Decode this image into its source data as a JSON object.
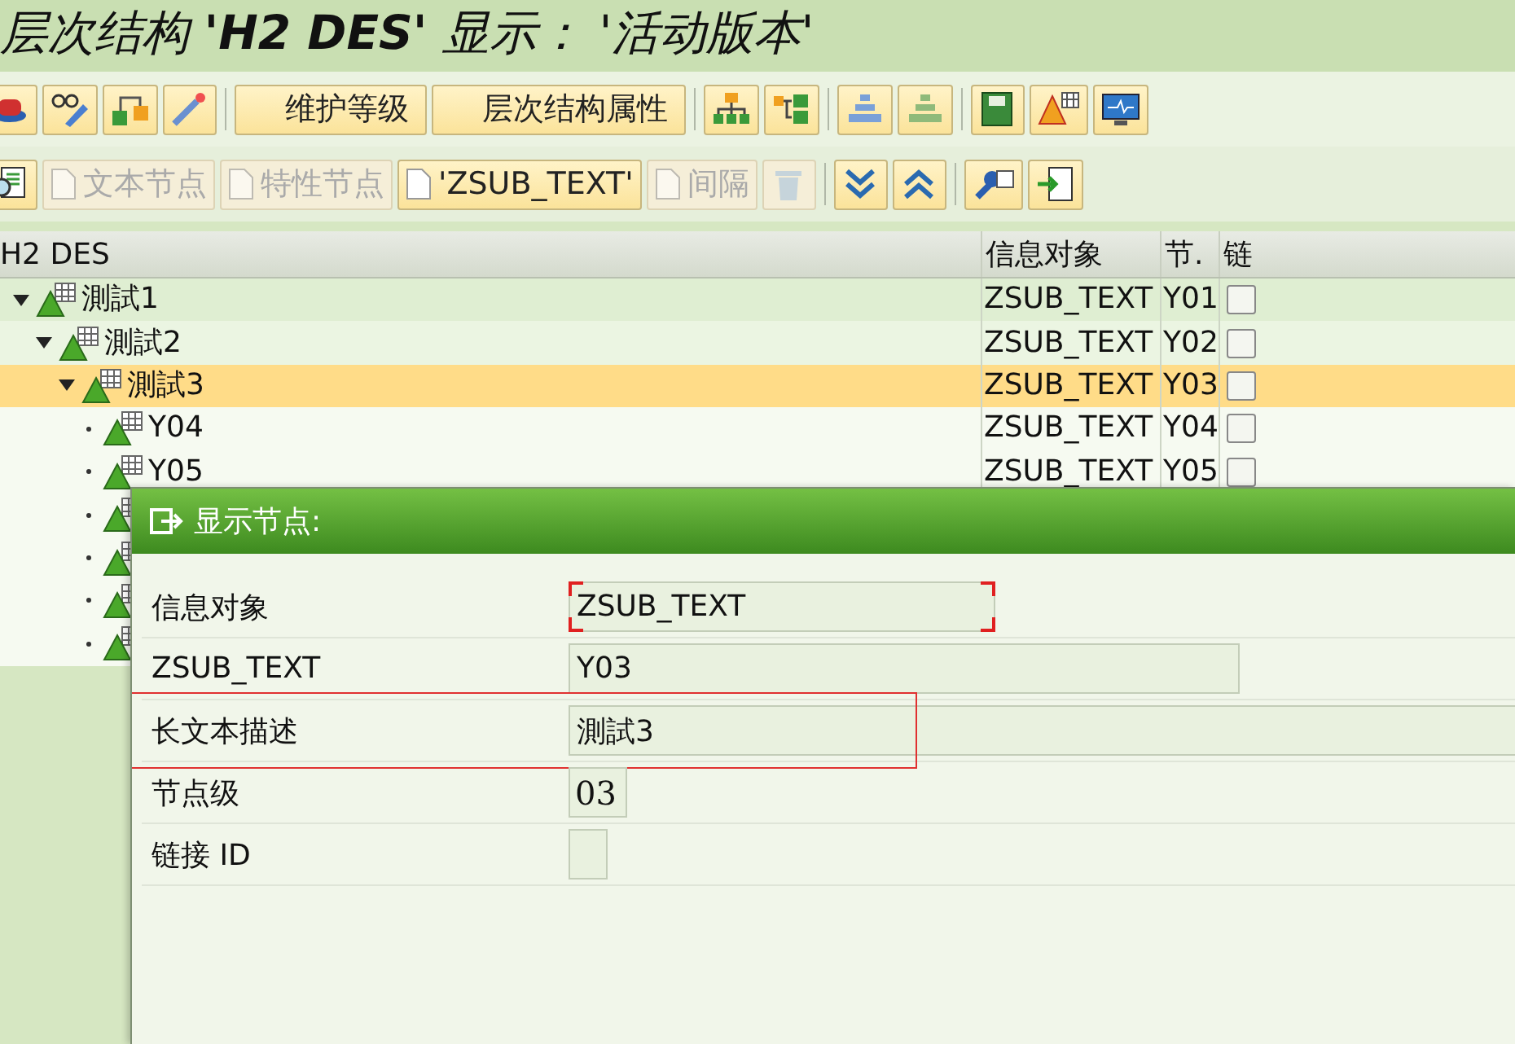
{
  "window": {
    "title": "层次结构 **'H2 DES'** 显示： '活动版本'"
  },
  "toolbars": [
    {
      "items": [
        {
          "kind": "icon",
          "disabled": false
        },
        {
          "kind": "icon",
          "disabled": false
        },
        {
          "kind": "icon",
          "disabled": false
        },
        {
          "kind": "icon",
          "disabled": false
        },
        {
          "kind": "separator"
        },
        {
          "kind": "text",
          "label": "维护等级",
          "disabled": false
        },
        {
          "kind": "text",
          "label": "层次结构属性",
          "disabled": false
        },
        {
          "kind": "separator"
        },
        {
          "kind": "icon",
          "disabled": false
        },
        {
          "kind": "icon",
          "disabled": false
        },
        {
          "kind": "separator"
        },
        {
          "kind": "icon",
          "disabled": false
        },
        {
          "kind": "icon",
          "disabled": false
        },
        {
          "kind": "separator"
        },
        {
          "kind": "icon",
          "disabled": false
        },
        {
          "kind": "icon",
          "disabled": false
        },
        {
          "kind": "icon",
          "disabled": false
        }
      ]
    },
    {
      "items": [
        {
          "kind": "icon",
          "disabled": false
        },
        {
          "kind": "doc-text",
          "label": "文本节点",
          "disabled": true
        },
        {
          "kind": "doc-text",
          "label": "特性节点",
          "disabled": true
        },
        {
          "kind": "doc-text",
          "label": "'ZSUB_TEXT'",
          "disabled": false
        },
        {
          "kind": "doc-text",
          "label": "间隔",
          "disabled": true
        },
        {
          "kind": "icon",
          "disabled": true
        },
        {
          "kind": "separator"
        },
        {
          "kind": "icon",
          "disabled": false
        },
        {
          "kind": "icon",
          "disabled": false
        },
        {
          "kind": "separator"
        },
        {
          "kind": "icon",
          "disabled": false
        },
        {
          "kind": "icon",
          "disabled": false
        }
      ]
    }
  ],
  "tree": {
    "columns": [
      "H2 DES",
      "信息对象",
      "节.",
      "链"
    ],
    "rows": [
      {
        "label": "測試1",
        "info": "ZSUB_TEXT",
        "node": "Y01",
        "linked": false,
        "expanded": true,
        "selected": false,
        "children": [
          {
            "label": "測試2",
            "info": "ZSUB_TEXT",
            "node": "Y02",
            "linked": false,
            "expanded": true,
            "selected": false,
            "children": [
              {
                "label": "測試3",
                "info": "ZSUB_TEXT",
                "node": "Y03",
                "linked": false,
                "expanded": true,
                "selected": true,
                "children": [
                  {
                    "label": "Y04",
                    "info": "ZSUB_TEXT",
                    "node": "Y04",
                    "linked": false,
                    "selected": false
                  },
                  {
                    "label": "Y05",
                    "info": "ZSUB_TEXT",
                    "node": "Y05",
                    "linked": false,
                    "selected": false
                  },
                  {
                    "selected": false
                  },
                  {
                    "selected": false
                  },
                  {
                    "selected": false
                  },
                  {
                    "selected": false
                  }
                ]
              }
            ]
          }
        ]
      }
    ]
  },
  "dialog": {
    "title": "显示节点:",
    "fields": [
      {
        "label": "信息对象",
        "value": "ZSUB_TEXT",
        "kind": "text",
        "focused": true,
        "highlighted": false
      },
      {
        "label": "ZSUB_TEXT",
        "value": "Y03",
        "kind": "text",
        "focused": false,
        "highlighted": false
      },
      {
        "label": "长文本描述",
        "value": "測試3",
        "kind": "text",
        "focused": false,
        "highlighted": true
      },
      {
        "label": "节点级",
        "value": "03",
        "kind": "numeric",
        "focused": false,
        "highlighted": false
      },
      {
        "label": "链接 ID",
        "kind": "text",
        "focused": false,
        "highlighted": false
      }
    ]
  }
}
